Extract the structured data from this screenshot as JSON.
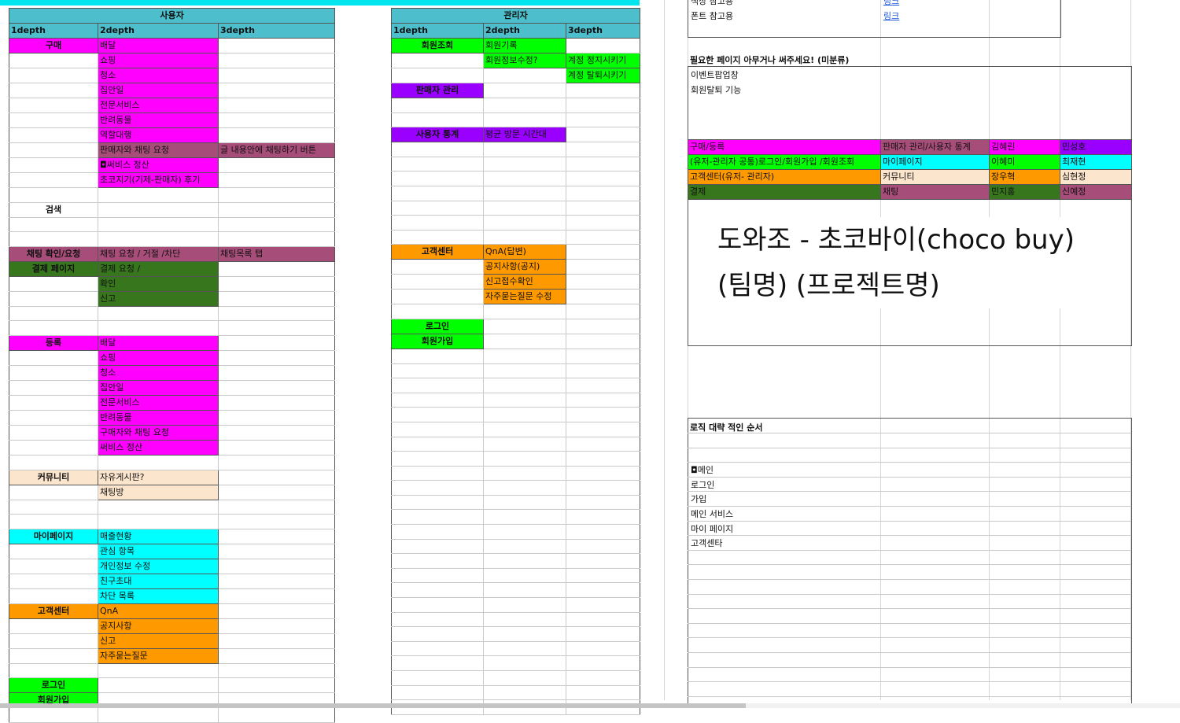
{
  "user": {
    "title": "사용자",
    "headers": [
      "1depth",
      "2depth",
      "3depth"
    ],
    "rows": [
      {
        "c1": "구매",
        "b1": "#ff00ff",
        "c2": "배달",
        "b2": "#ff00ff",
        "c3": "",
        "b3": ""
      },
      {
        "c1": "",
        "b1": "",
        "c2": "쇼핑",
        "b2": "#ff00ff",
        "c3": "",
        "b3": ""
      },
      {
        "c1": "",
        "b1": "",
        "c2": "청소",
        "b2": "#ff00ff",
        "c3": "",
        "b3": ""
      },
      {
        "c1": "",
        "b1": "",
        "c2": "집안일",
        "b2": "#ff00ff",
        "c3": "",
        "b3": ""
      },
      {
        "c1": "",
        "b1": "",
        "c2": "전문서비스",
        "b2": "#ff00ff",
        "c3": "",
        "b3": ""
      },
      {
        "c1": "",
        "b1": "",
        "c2": "반려동물",
        "b2": "#ff00ff",
        "c3": "",
        "b3": ""
      },
      {
        "c1": "",
        "b1": "",
        "c2": "역할대행",
        "b2": "#ff00ff",
        "c3": "",
        "b3": ""
      },
      {
        "c1": "",
        "b1": "",
        "c2": "판매자와 채팅 요청",
        "b2": "#a64d79",
        "c3": "글 내용안에 채팅하기 버튼",
        "b3": "#a64d79"
      },
      {
        "c1": "",
        "b1": "",
        "c2": "◘써비스 정산",
        "b2": "#ff00ff",
        "c3": "",
        "b3": ""
      },
      {
        "c1": "",
        "b1": "",
        "c2": "초코지기(기제-판매자) 후기",
        "b2": "#ff00ff",
        "c3": "",
        "b3": ""
      },
      {
        "c1": "",
        "b1": "",
        "c2": "",
        "b2": "",
        "c3": "",
        "b3": ""
      },
      {
        "c1": "검색",
        "b1": "",
        "c2": "",
        "b2": "",
        "c3": "",
        "b3": ""
      },
      {
        "c1": "",
        "b1": "",
        "c2": "",
        "b2": "",
        "c3": "",
        "b3": ""
      },
      {
        "c1": "",
        "b1": "",
        "c2": "",
        "b2": "",
        "c3": "",
        "b3": ""
      },
      {
        "c1": "채팅 확인/요청",
        "b1": "#a64d79",
        "c2": "채팅 요청 / 거절 /차단",
        "b2": "#a64d79",
        "c3": "채팅목록 탭",
        "b3": "#a64d79"
      },
      {
        "c1": "결제 페이지",
        "b1": "#38761d",
        "c2": "결제 요청 /",
        "b2": "#38761d",
        "c3": "",
        "b3": ""
      },
      {
        "c1": "",
        "b1": "",
        "c2": "확인",
        "b2": "#38761d",
        "c3": "",
        "b3": ""
      },
      {
        "c1": "",
        "b1": "",
        "c2": "신고",
        "b2": "#38761d",
        "c3": "",
        "b3": ""
      },
      {
        "c1": "",
        "b1": "",
        "c2": "",
        "b2": "",
        "c3": "",
        "b3": ""
      },
      {
        "c1": "",
        "b1": "",
        "c2": "",
        "b2": "",
        "c3": "",
        "b3": ""
      },
      {
        "c1": "등록",
        "b1": "#ff00ff",
        "c2": "배달",
        "b2": "#ff00ff",
        "c3": "",
        "b3": ""
      },
      {
        "c1": "",
        "b1": "",
        "c2": "쇼핑",
        "b2": "#ff00ff",
        "c3": "",
        "b3": ""
      },
      {
        "c1": "",
        "b1": "",
        "c2": "청소",
        "b2": "#ff00ff",
        "c3": "",
        "b3": ""
      },
      {
        "c1": "",
        "b1": "",
        "c2": "집안일",
        "b2": "#ff00ff",
        "c3": "",
        "b3": ""
      },
      {
        "c1": "",
        "b1": "",
        "c2": "전문서비스",
        "b2": "#ff00ff",
        "c3": "",
        "b3": ""
      },
      {
        "c1": "",
        "b1": "",
        "c2": "반려동물",
        "b2": "#ff00ff",
        "c3": "",
        "b3": ""
      },
      {
        "c1": "",
        "b1": "",
        "c2": "구매자와 채팅 요청",
        "b2": "#ff00ff",
        "c3": "",
        "b3": ""
      },
      {
        "c1": "",
        "b1": "",
        "c2": "써비스 정산",
        "b2": "#ff00ff",
        "c3": "",
        "b3": ""
      },
      {
        "c1": "",
        "b1": "",
        "c2": "",
        "b2": "",
        "c3": "",
        "b3": ""
      },
      {
        "c1": "커뮤니티",
        "b1": "#fce5cd",
        "c2": "자유게시판?",
        "b2": "#fce5cd",
        "c3": "",
        "b3": ""
      },
      {
        "c1": "",
        "b1": "",
        "c2": "채팅방",
        "b2": "#fce5cd",
        "c3": "",
        "b3": ""
      },
      {
        "c1": "",
        "b1": "",
        "c2": "",
        "b2": "",
        "c3": "",
        "b3": ""
      },
      {
        "c1": "",
        "b1": "",
        "c2": "",
        "b2": "",
        "c3": "",
        "b3": ""
      },
      {
        "c1": "마이페이지",
        "b1": "#00ffff",
        "c2": "매출현황",
        "b2": "#00ffff",
        "c3": "",
        "b3": ""
      },
      {
        "c1": "",
        "b1": "",
        "c2": "관심 항목",
        "b2": "#00ffff",
        "c3": "",
        "b3": ""
      },
      {
        "c1": "",
        "b1": "",
        "c2": "개인정보 수정",
        "b2": "#00ffff",
        "c3": "",
        "b3": ""
      },
      {
        "c1": "",
        "b1": "",
        "c2": "친구초대",
        "b2": "#00ffff",
        "c3": "",
        "b3": ""
      },
      {
        "c1": "",
        "b1": "",
        "c2": "차단 목록",
        "b2": "#00ffff",
        "c3": "",
        "b3": ""
      },
      {
        "c1": "고객센터",
        "b1": "#ff9900",
        "c2": "QnA",
        "b2": "#ff9900",
        "c3": "",
        "b3": ""
      },
      {
        "c1": "",
        "b1": "",
        "c2": "공지사항",
        "b2": "#ff9900",
        "c3": "",
        "b3": ""
      },
      {
        "c1": "",
        "b1": "",
        "c2": "신고",
        "b2": "#ff9900",
        "c3": "",
        "b3": ""
      },
      {
        "c1": "",
        "b1": "",
        "c2": "자주묻는질문",
        "b2": "#ff9900",
        "c3": "",
        "b3": ""
      },
      {
        "c1": "",
        "b1": "",
        "c2": "",
        "b2": "",
        "c3": "",
        "b3": ""
      },
      {
        "c1": "로그인",
        "b1": "#00ff00",
        "c2": "",
        "b2": "",
        "c3": "",
        "b3": ""
      },
      {
        "c1": "회원가입",
        "b1": "#00ff00",
        "c2": "",
        "b2": "",
        "c3": "",
        "b3": ""
      },
      {
        "c1": "",
        "b1": "",
        "c2": "",
        "b2": "",
        "c3": "",
        "b3": ""
      }
    ]
  },
  "admin": {
    "title": "관리자",
    "headers": [
      "1depth",
      "2depth",
      "3depth"
    ],
    "rows": [
      {
        "c1": "회원조회",
        "b1": "#00ff00",
        "c2": "회원기록",
        "b2": "#00ff00",
        "c3": "",
        "b3": ""
      },
      {
        "c1": "",
        "b1": "",
        "c2": "회원정보수정?",
        "b2": "#00ff00",
        "c3": "계정 정지시키기",
        "b3": "#00ff00"
      },
      {
        "c1": "",
        "b1": "",
        "c2": "",
        "b2": "",
        "c3": "계정 탈퇴시키기",
        "b3": "#00ff00"
      },
      {
        "c1": "판매자 관리",
        "b1": "#9900ff",
        "c2": "",
        "b2": "",
        "c3": "",
        "b3": ""
      },
      {
        "c1": "",
        "b1": "",
        "c2": "",
        "b2": "",
        "c3": "",
        "b3": ""
      },
      {
        "c1": "",
        "b1": "",
        "c2": "",
        "b2": "",
        "c3": "",
        "b3": ""
      },
      {
        "c1": "사용자 통계",
        "b1": "#9900ff",
        "c2": "평균 방문 시간대",
        "b2": "#9900ff",
        "c3": "",
        "b3": ""
      },
      {
        "c1": "",
        "b1": "",
        "c2": "",
        "b2": "",
        "c3": "",
        "b3": ""
      },
      {
        "c1": "",
        "b1": "",
        "c2": "",
        "b2": "",
        "c3": "",
        "b3": ""
      },
      {
        "c1": "",
        "b1": "",
        "c2": "",
        "b2": "",
        "c3": "",
        "b3": ""
      },
      {
        "c1": "",
        "b1": "",
        "c2": "",
        "b2": "",
        "c3": "",
        "b3": ""
      },
      {
        "c1": "",
        "b1": "",
        "c2": "",
        "b2": "",
        "c3": "",
        "b3": ""
      },
      {
        "c1": "",
        "b1": "",
        "c2": "",
        "b2": "",
        "c3": "",
        "b3": ""
      },
      {
        "c1": "",
        "b1": "",
        "c2": "",
        "b2": "",
        "c3": "",
        "b3": ""
      },
      {
        "c1": "고객센터",
        "b1": "#ff9900",
        "c2": "QnA(답변)",
        "b2": "#ff9900",
        "c3": "",
        "b3": ""
      },
      {
        "c1": "",
        "b1": "",
        "c2": "공지사항(공지)",
        "b2": "#ff9900",
        "c3": "",
        "b3": ""
      },
      {
        "c1": "",
        "b1": "",
        "c2": "신고접수확인",
        "b2": "#ff9900",
        "c3": "",
        "b3": ""
      },
      {
        "c1": "",
        "b1": "",
        "c2": "자주묻는질문 수정",
        "b2": "#ff9900",
        "c3": "",
        "b3": ""
      },
      {
        "c1": "",
        "b1": "",
        "c2": "",
        "b2": "",
        "c3": "",
        "b3": ""
      },
      {
        "c1": "로그인",
        "b1": "#00ff00",
        "c2": "",
        "b2": "",
        "c3": "",
        "b3": ""
      },
      {
        "c1": "회원가입",
        "b1": "#00ff00",
        "c2": "",
        "b2": "",
        "c3": "",
        "b3": ""
      },
      {
        "c1": "",
        "b1": "",
        "c2": "",
        "b2": "",
        "c3": "",
        "b3": ""
      },
      {
        "c1": "",
        "b1": "",
        "c2": "",
        "b2": "",
        "c3": "",
        "b3": ""
      },
      {
        "c1": "",
        "b1": "",
        "c2": "",
        "b2": "",
        "c3": "",
        "b3": ""
      },
      {
        "c1": "",
        "b1": "",
        "c2": "",
        "b2": "",
        "c3": "",
        "b3": ""
      },
      {
        "c1": "",
        "b1": "",
        "c2": "",
        "b2": "",
        "c3": "",
        "b3": ""
      },
      {
        "c1": "",
        "b1": "",
        "c2": "",
        "b2": "",
        "c3": "",
        "b3": ""
      },
      {
        "c1": "",
        "b1": "",
        "c2": "",
        "b2": "",
        "c3": "",
        "b3": ""
      },
      {
        "c1": "",
        "b1": "",
        "c2": "",
        "b2": "",
        "c3": "",
        "b3": ""
      },
      {
        "c1": "",
        "b1": "",
        "c2": "",
        "b2": "",
        "c3": "",
        "b3": ""
      },
      {
        "c1": "",
        "b1": "",
        "c2": "",
        "b2": "",
        "c3": "",
        "b3": ""
      },
      {
        "c1": "",
        "b1": "",
        "c2": "",
        "b2": "",
        "c3": "",
        "b3": ""
      },
      {
        "c1": "",
        "b1": "",
        "c2": "",
        "b2": "",
        "c3": "",
        "b3": ""
      },
      {
        "c1": "",
        "b1": "",
        "c2": "",
        "b2": "",
        "c3": "",
        "b3": ""
      },
      {
        "c1": "",
        "b1": "",
        "c2": "",
        "b2": "",
        "c3": "",
        "b3": ""
      },
      {
        "c1": "",
        "b1": "",
        "c2": "",
        "b2": "",
        "c3": "",
        "b3": ""
      },
      {
        "c1": "",
        "b1": "",
        "c2": "",
        "b2": "",
        "c3": "",
        "b3": ""
      },
      {
        "c1": "",
        "b1": "",
        "c2": "",
        "b2": "",
        "c3": "",
        "b3": ""
      },
      {
        "c1": "",
        "b1": "",
        "c2": "",
        "b2": "",
        "c3": "",
        "b3": ""
      },
      {
        "c1": "",
        "b1": "",
        "c2": "",
        "b2": "",
        "c3": "",
        "b3": ""
      },
      {
        "c1": "",
        "b1": "",
        "c2": "",
        "b2": "",
        "c3": "",
        "b3": ""
      },
      {
        "c1": "",
        "b1": "",
        "c2": "",
        "b2": "",
        "c3": "",
        "b3": ""
      },
      {
        "c1": "",
        "b1": "",
        "c2": "",
        "b2": "",
        "c3": "",
        "b3": ""
      },
      {
        "c1": "",
        "b1": "",
        "c2": "",
        "b2": "",
        "c3": "",
        "b3": ""
      },
      {
        "c1": "",
        "b1": "",
        "c2": "",
        "b2": "",
        "c3": "",
        "b3": ""
      },
      {
        "c1": "",
        "b1": "",
        "c2": "",
        "b2": "",
        "c3": "",
        "b3": ""
      }
    ]
  },
  "refs": {
    "items": [
      {
        "label": "색상 참고용",
        "link": "링크"
      },
      {
        "label": "폰트 참고용",
        "link": "링크"
      }
    ]
  },
  "pages": {
    "title": "필요한 페이지 아무거나 써주세요! (미분류)",
    "items": [
      "이벤트팝업창",
      "회원탈퇴 기능"
    ]
  },
  "legend": {
    "rows": [
      {
        "task": "구매/등록",
        "task_color": "#ff00ff",
        "task2": "판매자 관리/사용자 통계",
        "task2_color": "#a64d79",
        "m1": "김혜린",
        "m1_color": "#ff00ff",
        "m2": "민성호",
        "m2_color": "#9900ff"
      },
      {
        "task": "(유저-관리자 공통)로그인/회원가입 /회원조회",
        "task_color": "#00ff00",
        "task2": "마이페이지",
        "task2_color": "#00ffff",
        "m1": "이혜미",
        "m1_color": "#00ff00",
        "m2": "최재현",
        "m2_color": "#00ffff"
      },
      {
        "task": "고객센터(유저- 관리자)",
        "task_color": "#ff9900",
        "task2": "커뮤니티",
        "task2_color": "#fce5cd",
        "m1": "장우혁",
        "m1_color": "#ff9900",
        "m2": "심현정",
        "m2_color": "#fce5cd"
      },
      {
        "task": "결제",
        "task_color": "#38761d",
        "task2": "채팅",
        "task2_color": "#a64d79",
        "m1": "민지홍",
        "m1_color": "#38761d",
        "m2": "신예정",
        "m2_color": "#a64d79"
      }
    ]
  },
  "banner": {
    "line1": "도와조 - 초코바이(choco buy)",
    "line2": "(팀명)      (프로젝트명)"
  },
  "order": {
    "title": "로직 대략 적인 순서",
    "items": [
      "◘메인",
      "로그인",
      "가입",
      "메인 서비스",
      "마이 페이지",
      "고객센타"
    ]
  }
}
